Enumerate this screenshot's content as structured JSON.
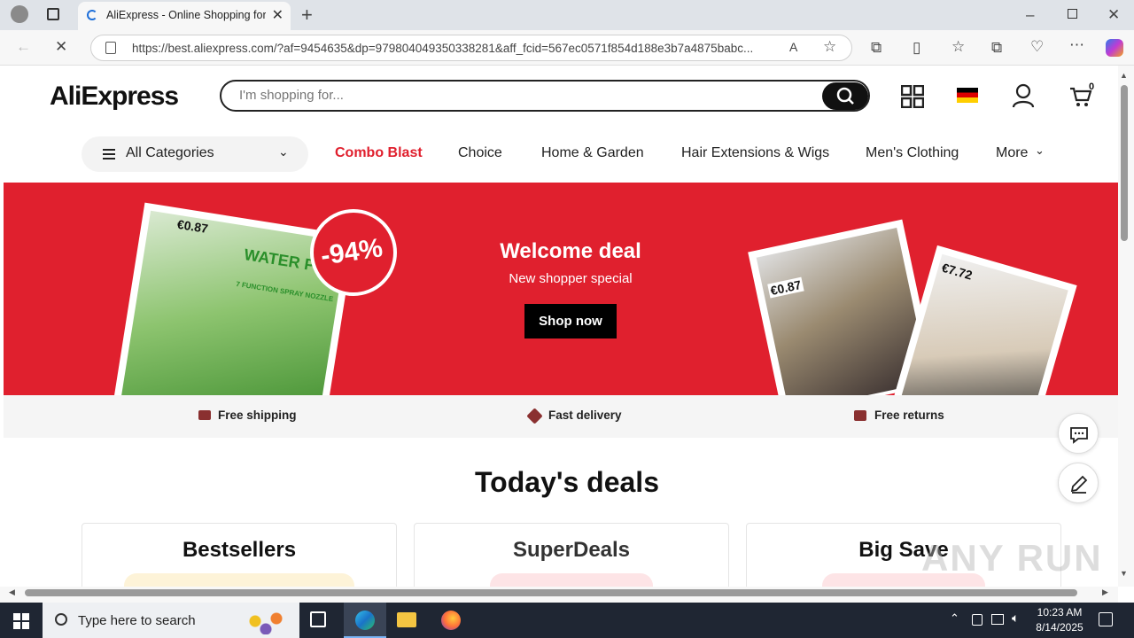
{
  "browser": {
    "tab_title": "AliExpress - Online Shopping for Popular Electronics",
    "url": "https://best.aliexpress.com/?af=9454635&dp=979804049350338281&aff_fcid=567ec0571f854d188e3b7a4875babc..."
  },
  "header": {
    "logo": "AliExpress",
    "search_placeholder": "I'm shopping for...",
    "cart_count": "0"
  },
  "nav": {
    "all_categories": "All Categories",
    "items": [
      "Combo Blast",
      "Choice",
      "Home & Garden",
      "Hair Extensions & Wigs",
      "Men's Clothing",
      "More"
    ]
  },
  "banner": {
    "title": "Welcome deal",
    "subtitle": "New shopper special",
    "cta": "Shop now",
    "discount": "-94%",
    "price_left": "€0.87",
    "price_mid": "€0.87",
    "price_right": "€7.72",
    "product_caption": "WATER P",
    "product_caption2": "7 FUNCTION SPRAY NOZZLE",
    "accent_color": "#e0202e"
  },
  "features": [
    "Free shipping",
    "Fast delivery",
    "Free returns"
  ],
  "deals": {
    "title": "Today's deals",
    "cards": [
      "Bestsellers",
      "SuperDeals",
      "Big Save"
    ]
  },
  "taskbar": {
    "search_placeholder": "Type here to search",
    "time": "10:23 AM",
    "date": "8/14/2025"
  },
  "watermark": "ANY RUN"
}
